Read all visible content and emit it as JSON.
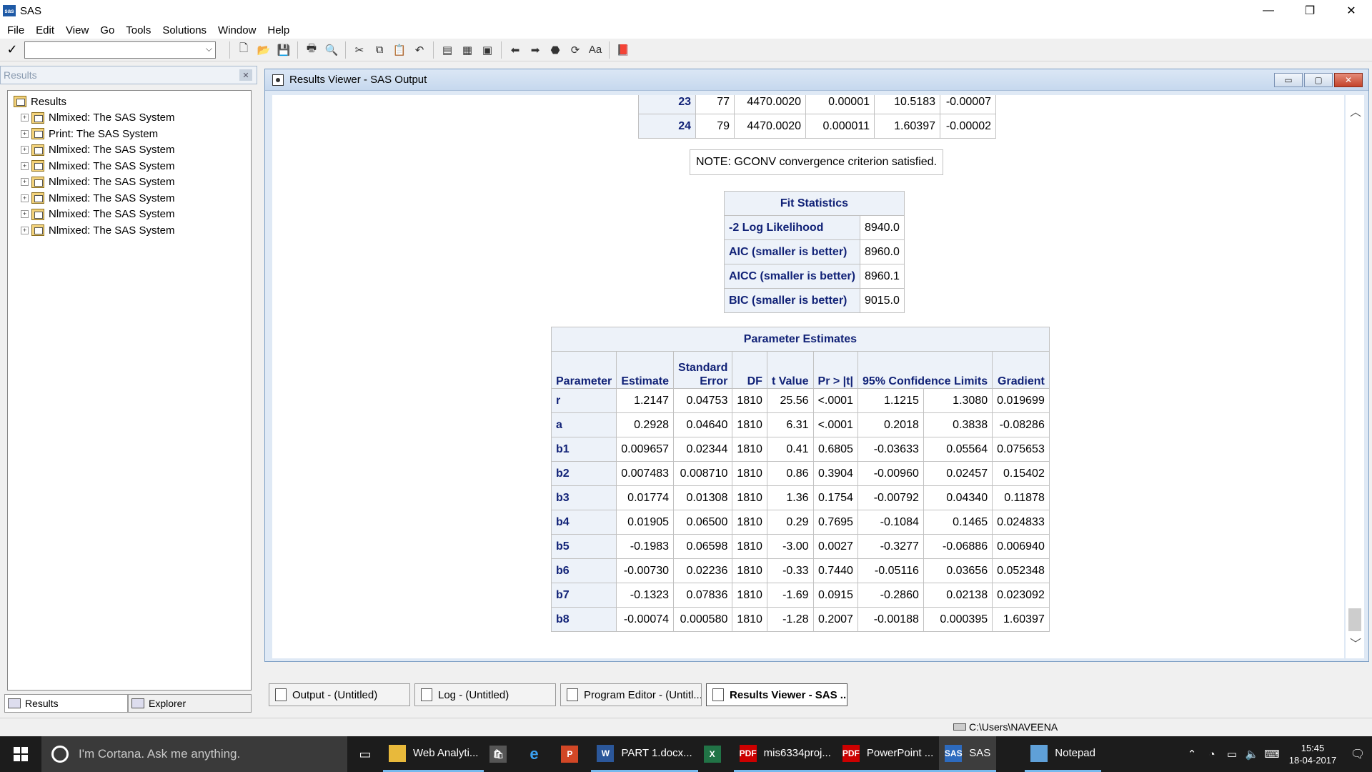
{
  "window": {
    "title": "SAS",
    "controls": [
      "—",
      "❐",
      "✕"
    ]
  },
  "menu": [
    "File",
    "Edit",
    "View",
    "Go",
    "Tools",
    "Solutions",
    "Window",
    "Help"
  ],
  "toolbar": {
    "command_value": ""
  },
  "results_pane": {
    "header": "Results",
    "root": "Results",
    "items": [
      "Nlmixed:  The SAS System",
      "Print:  The SAS System",
      "Nlmixed:  The SAS System",
      "Nlmixed:  The SAS System",
      "Nlmixed:  The SAS System",
      "Nlmixed:  The SAS System",
      "Nlmixed:  The SAS System",
      "Nlmixed:  The SAS System"
    ],
    "tabs": [
      "Results",
      "Explorer"
    ]
  },
  "viewer": {
    "title": "Results Viewer - SAS Output",
    "iterations": [
      [
        "23",
        "77",
        "4470.0020",
        "0.00001",
        "10.5183",
        "-0.00007"
      ],
      [
        "24",
        "79",
        "4470.0020",
        "0.000011",
        "1.60397",
        "-0.00002"
      ]
    ],
    "note": "NOTE: GCONV convergence criterion satisfied.",
    "fit": {
      "title": "Fit Statistics",
      "rows": [
        [
          "-2 Log Likelihood",
          "8940.0"
        ],
        [
          "AIC (smaller is better)",
          "8960.0"
        ],
        [
          "AICC (smaller is better)",
          "8960.1"
        ],
        [
          "BIC (smaller is better)",
          "9015.0"
        ]
      ]
    },
    "params": {
      "title": "Parameter Estimates",
      "headers": [
        "Parameter",
        "Estimate",
        "Standard Error",
        "DF",
        "t Value",
        "Pr > |t|",
        "95% Confidence Limits",
        "Gradient"
      ],
      "rows": [
        [
          "r",
          "1.2147",
          "0.04753",
          "1810",
          "25.56",
          "<.0001",
          "1.1215",
          "1.3080",
          "0.019699"
        ],
        [
          "a",
          "0.2928",
          "0.04640",
          "1810",
          "6.31",
          "<.0001",
          "0.2018",
          "0.3838",
          "-0.08286"
        ],
        [
          "b1",
          "0.009657",
          "0.02344",
          "1810",
          "0.41",
          "0.6805",
          "-0.03633",
          "0.05564",
          "0.075653"
        ],
        [
          "b2",
          "0.007483",
          "0.008710",
          "1810",
          "0.86",
          "0.3904",
          "-0.00960",
          "0.02457",
          "0.15402"
        ],
        [
          "b3",
          "0.01774",
          "0.01308",
          "1810",
          "1.36",
          "0.1754",
          "-0.00792",
          "0.04340",
          "0.11878"
        ],
        [
          "b4",
          "0.01905",
          "0.06500",
          "1810",
          "0.29",
          "0.7695",
          "-0.1084",
          "0.1465",
          "0.024833"
        ],
        [
          "b5",
          "-0.1983",
          "0.06598",
          "1810",
          "-3.00",
          "0.0027",
          "-0.3277",
          "-0.06886",
          "0.006940"
        ],
        [
          "b6",
          "-0.00730",
          "0.02236",
          "1810",
          "-0.33",
          "0.7440",
          "-0.05116",
          "0.03656",
          "0.052348"
        ],
        [
          "b7",
          "-0.1323",
          "0.07836",
          "1810",
          "-1.69",
          "0.0915",
          "-0.2860",
          "0.02138",
          "0.023092"
        ],
        [
          "b8",
          "-0.00074",
          "0.000580",
          "1810",
          "-1.28",
          "0.2007",
          "-0.00188",
          "0.000395",
          "1.60397"
        ]
      ]
    }
  },
  "window_tabs": [
    "Output - (Untitled)",
    "Log - (Untitled)",
    "Program Editor - (Untitl...",
    "Results Viewer - SAS ..."
  ],
  "status": {
    "path": "C:\\Users\\NAVEENA"
  },
  "taskbar": {
    "search_placeholder": "I'm Cortana. Ask me anything.",
    "apps": [
      "Web Analyti...",
      "",
      "",
      "",
      "PART 1.docx...",
      "",
      "mis6334proj...",
      "PowerPoint ...",
      "SAS",
      "Notepad"
    ],
    "time": "15:45",
    "date": "18-04-2017"
  }
}
